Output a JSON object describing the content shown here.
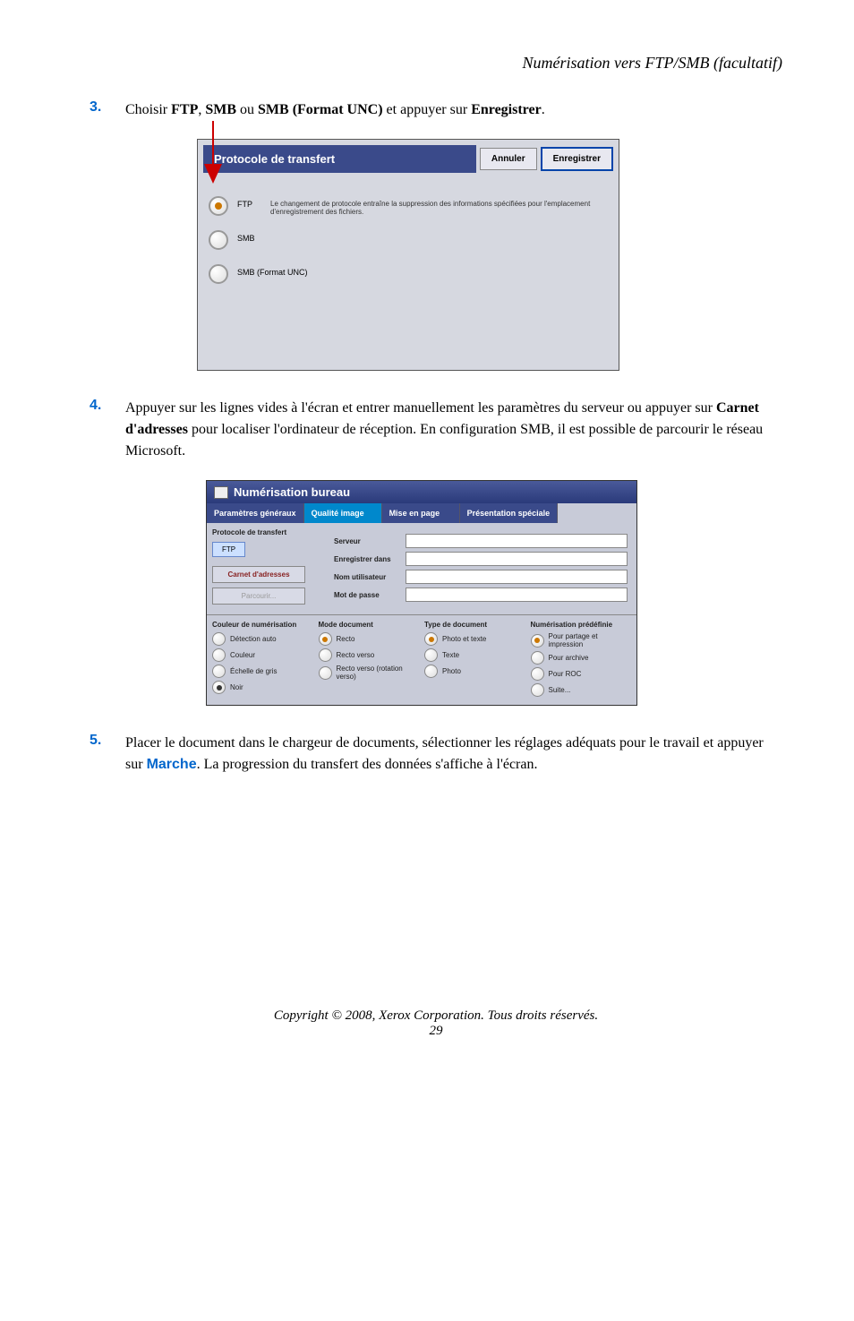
{
  "header": "Numérisation vers FTP/SMB (facultatif)",
  "steps": {
    "s3": {
      "num": "3.",
      "t1": "Choisir ",
      "b1": "FTP",
      "t2": ", ",
      "b2": "SMB",
      "t3": " ou ",
      "b3": "SMB (Format UNC)",
      "t4": " et appuyer sur ",
      "b4": "Enregistrer",
      "t5": "."
    },
    "s4": {
      "num": "4.",
      "t1": "Appuyer sur les lignes vides à l'écran et entrer manuellement les paramètres du serveur ou appuyer sur ",
      "b1": "Carnet d'adresses",
      "t2": " pour localiser l'ordinateur de réception. En configuration SMB, il est possible de parcourir le réseau Microsoft."
    },
    "s5": {
      "num": "5.",
      "t1": "Placer le document dans le chargeur de documents, sélectionner les réglages adéquats pour le travail et appuyer sur ",
      "b1": "Marche",
      "t2": ". La progression du transfert des données s'affiche à l'écran."
    }
  },
  "dialog1": {
    "title": "Protocole de transfert",
    "cancel": "Annuler",
    "save": "Enregistrer",
    "note": "Le changement de protocole entraîne la suppression des informations spécifiées pour l'emplacement d'enregistrement des fichiers.",
    "opt1": "FTP",
    "opt2": "SMB",
    "opt3": "SMB (Format UNC)"
  },
  "dialog2": {
    "title": "Numérisation bureau",
    "tab1": "Paramètres généraux",
    "tab2": "Qualité image",
    "tab3": "Mise en page",
    "tab4": "Présentation spéciale",
    "protoTitle": "Protocole de transfert",
    "proto": "FTP",
    "btnCarnet": "Carnet d'adresses",
    "btnParcourir": "Parcourir...",
    "f1": "Serveur",
    "f2": "Enregistrer dans",
    "f3": "Nom utilisateur",
    "f4": "Mot de passe",
    "col1": {
      "title": "Couleur de numérisation",
      "o1": "Détection auto",
      "o2": "Couleur",
      "o3": "Échelle de gris",
      "o4": "Noir"
    },
    "col2": {
      "title": "Mode document",
      "o1": "Recto",
      "o2": "Recto verso",
      "o3": "Recto verso (rotation verso)"
    },
    "col3": {
      "title": "Type de document",
      "o1": "Photo et texte",
      "o2": "Texte",
      "o3": "Photo"
    },
    "col4": {
      "title": "Numérisation prédéfinie",
      "o1": "Pour partage et impression",
      "o2": "Pour archive",
      "o3": "Pour ROC",
      "o4": "Suite..."
    }
  },
  "footer": "Copyright © 2008, Xerox Corporation. Tous droits réservés.",
  "pagenum": "29"
}
